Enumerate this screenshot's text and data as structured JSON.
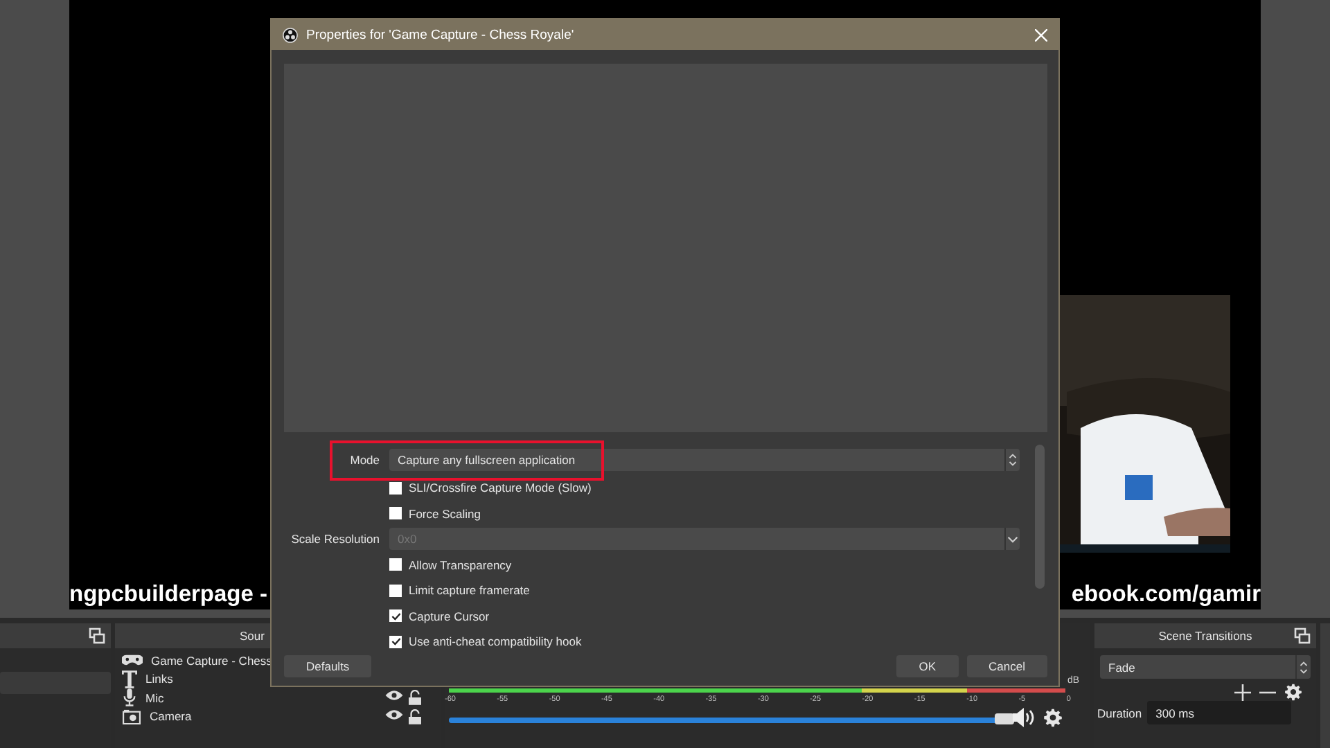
{
  "preview": {
    "overlay_texts": [
      "ngpcbuilderpage -",
      "ebook.com/gamir"
    ]
  },
  "sources": {
    "title": "Sour",
    "items": [
      {
        "kind": "gamepad",
        "name": "Game Capture - Chess"
      },
      {
        "kind": "text",
        "name": "Links"
      },
      {
        "kind": "mic",
        "name": "Mic",
        "visible": true
      },
      {
        "kind": "camera",
        "name": "Camera",
        "visible": true
      }
    ]
  },
  "mixer": {
    "reading": "dB",
    "scale": [
      "-60",
      "-55",
      "-50",
      "-45",
      "-40",
      "-35",
      "-30",
      "-25",
      "-20",
      "-15",
      "-10",
      "-5",
      "0"
    ],
    "level": 0.99
  },
  "transitions": {
    "title": "Scene Transitions",
    "transition": "Fade",
    "duration_label": "Duration",
    "duration": "300 ms"
  },
  "dialog": {
    "title": "Properties for 'Game Capture - Chess Royale'",
    "rows": [
      {
        "kind": "select",
        "label": "Mode",
        "value": "Capture any fullscreen application",
        "disabled": false,
        "highlighted": true
      },
      {
        "kind": "checkbox",
        "label": "SLI/Crossfire Capture Mode (Slow)",
        "checked": false
      },
      {
        "kind": "checkbox",
        "label": "Force Scaling",
        "checked": false
      },
      {
        "kind": "select",
        "label": "Scale Resolution",
        "value": "0x0",
        "disabled": true,
        "highlighted": false
      },
      {
        "kind": "checkbox",
        "label": "Allow Transparency",
        "checked": false
      },
      {
        "kind": "checkbox",
        "label": "Limit capture framerate",
        "checked": false
      },
      {
        "kind": "checkbox",
        "label": "Capture Cursor",
        "checked": true
      },
      {
        "kind": "checkbox",
        "label": "Use anti-cheat compatibility hook",
        "checked": true
      }
    ],
    "buttons": {
      "defaults": "Defaults",
      "ok": "OK",
      "cancel": "Cancel"
    }
  }
}
